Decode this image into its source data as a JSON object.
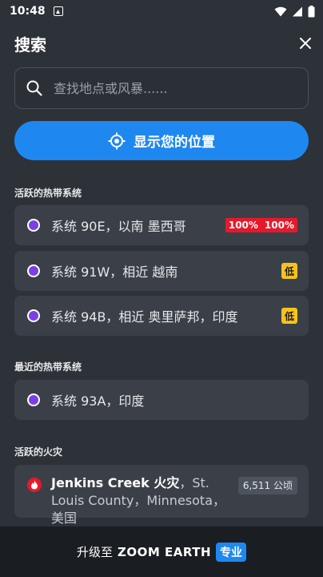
{
  "status_bar": {
    "time": "10:48"
  },
  "header": {
    "title": "搜索"
  },
  "search": {
    "placeholder": "查找地点或风暴......"
  },
  "location_button": {
    "label": "显示您的位置"
  },
  "sections": {
    "active_tropical": "活跃的热带系统",
    "recent_tropical": "最近的热带系统",
    "active_fires": "活跃的火灾"
  },
  "active_systems": [
    {
      "label": "系统 90E，以南 墨西哥",
      "badge_a": "100%",
      "badge_b": "100%"
    },
    {
      "label": "系统 91W，相近 越南",
      "badge": "低"
    },
    {
      "label": "系统 94B，相近 奥里萨邦，印度",
      "badge": "低"
    }
  ],
  "recent_systems": [
    {
      "label": "系统 93A，印度"
    }
  ],
  "fires": [
    {
      "name": "Jenkins Creek 火灾",
      "place_line1": "，St.",
      "place_line2": "Louis County，Minnesota，美国",
      "area": "6,511 公顷"
    }
  ],
  "bottom_bar": {
    "prefix": "升级至",
    "brand": "ZOOM EARTH",
    "pro": "专业"
  },
  "colors": {
    "background": "#2d3138",
    "card": "#3b4048",
    "accent": "#1e88f0",
    "storm_dot": "#7b3fe4",
    "high_badge": "#e6192b",
    "low_badge": "#f7c21d"
  }
}
